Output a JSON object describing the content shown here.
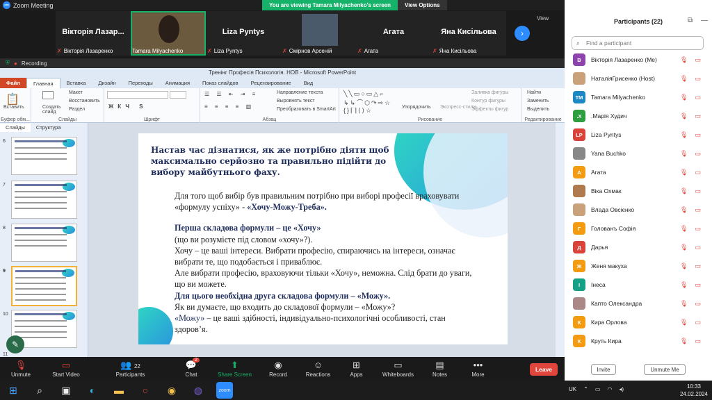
{
  "window": {
    "title": "Zoom Meeting",
    "banner_view": "You are viewing Tamara Milyachenko's screen",
    "banner_options": "View Options",
    "min": "—",
    "max": "☐",
    "close": "✕"
  },
  "video_strip": {
    "tiles": [
      {
        "name": "Вікторія Лазар...",
        "label": "Вікторія Лазаренко"
      },
      {
        "name": "",
        "label": "Tamara Milyachenko"
      },
      {
        "name": "Liza Pyntys",
        "label": "Liza Pyntys"
      },
      {
        "name": "",
        "label": "Смірнов Арсеній"
      },
      {
        "name": "Агата",
        "label": "Агата"
      },
      {
        "name": "Яна Кисільова",
        "label": "Яна Кисільова"
      }
    ],
    "view": "View"
  },
  "recording": "Recording",
  "ppt": {
    "title": "Тренінг Професія Психологія. НОВ - Microsoft PowerPoint",
    "tabs": [
      "Файл",
      "Главная",
      "Вставка",
      "Дизайн",
      "Переходы",
      "Анимация",
      "Показ слайдов",
      "Рецензирование",
      "Вид"
    ],
    "groups": [
      "Буфер обм...",
      "Слайды",
      "Шрифт",
      "Абзац",
      "Рисование",
      "Редактирование"
    ],
    "ribbon": {
      "paste": "Вставить",
      "create": "Создать слайд",
      "layout": "Макет",
      "restore": "Восстановить",
      "section": "Раздел",
      "text_dir": "Направление текста",
      "align_text": "Выровнять текст",
      "smartart": "Преобразовать в SmartArt",
      "arrange": "Упорядочить",
      "quick": "Экспресс-стили",
      "fill": "Заливка фигуры",
      "outline": "Контур фигуры",
      "effects": "Эффекты фигур",
      "find": "Найти",
      "replace": "Заменить",
      "select": "Выделить"
    },
    "panel_tabs": [
      "Слайды",
      "Структура"
    ],
    "slide_numbers": [
      "6",
      "7",
      "8",
      "9",
      "10",
      "11"
    ],
    "slide": {
      "title": "Настав час дізнатися, як же потрібно діяти щоб максимально серйозно та правильно підійти до вибору майбутнього фаху.",
      "l1": "Для того щоб вибір був правильним потрібно при виборі професії враховувати «формулу успіху» - ",
      "l1b": "«Хочу-Можу-Треба».",
      "h1": "Перша складова формули – це «Хочу»",
      "l2": "(що ви розумієте під словом «хочу»?).",
      "l3": "Хочу – це ваші інтереси. Вибрати професію, спираючись на інтереси, означає вибрати те, що подобається і приваблює.",
      "l4": "Але вибрати професію, враховуючи тільки «Хочу», неможна. Слід брати до уваги, що ви можете.",
      "h2": "Для цього необхідна друга складова формули – «Можу».",
      "l5": "Як ви думаєте, що входить до складової формули – «Можу»?",
      "l6a": "«Можу»",
      "l6b": " – це ваші здібності, індивідуально-психологічні  особливості, стан здоров’я."
    }
  },
  "toolbar": {
    "unmute": "Unmute",
    "video": "Start Video",
    "participants": "Participants",
    "participants_count": "22",
    "chat": "Chat",
    "chat_badge": "2",
    "share": "Share Screen",
    "record": "Record",
    "reactions": "Reactions",
    "apps": "Apps",
    "whiteboards": "Whiteboards",
    "notes": "Notes",
    "more": "More",
    "leave": "Leave"
  },
  "panel": {
    "title": "Participants (22)",
    "search_placeholder": "Find a participant",
    "invite": "Invite",
    "unmute_me": "Unmute Me",
    "participants": [
      {
        "initial": "В",
        "color": "#8e44ad",
        "name": "Вікторія Лазаренко (Me)"
      },
      {
        "initial": "",
        "color": "#c9a27c",
        "name": "НаталіяГрисенко (Host)"
      },
      {
        "initial": "TM",
        "color": "#1e88c7",
        "name": "Tamara Milyachenko"
      },
      {
        "initial": ".Х",
        "color": "#2e9e3e",
        "name": ".Марія Худич"
      },
      {
        "initial": "LP",
        "color": "#d9433a",
        "name": "Liza Pyntys"
      },
      {
        "initial": "",
        "color": "#888",
        "name": "Yana Buchko"
      },
      {
        "initial": "А",
        "color": "#f39c12",
        "name": "Агата"
      },
      {
        "initial": "",
        "color": "#b07a4f",
        "name": "Віка Охмак"
      },
      {
        "initial": "",
        "color": "#c9a27c",
        "name": "Влада Овсієнко"
      },
      {
        "initial": "Г",
        "color": "#f39c12",
        "name": "Голованъ Софія"
      },
      {
        "initial": "Д",
        "color": "#d9433a",
        "name": "Дарья"
      },
      {
        "initial": "Ж",
        "color": "#f39c12",
        "name": "Женя макуха"
      },
      {
        "initial": "І",
        "color": "#16a085",
        "name": "Інеса"
      },
      {
        "initial": "",
        "color": "#a88",
        "name": "Капто Олександра"
      },
      {
        "initial": "К",
        "color": "#f39c12",
        "name": "Кира Орлова"
      },
      {
        "initial": "К",
        "color": "#f39c12",
        "name": "Круть Кира"
      }
    ]
  },
  "taskbar": {
    "lang": "UK",
    "time": "10:33",
    "date": "24.02.2024"
  }
}
